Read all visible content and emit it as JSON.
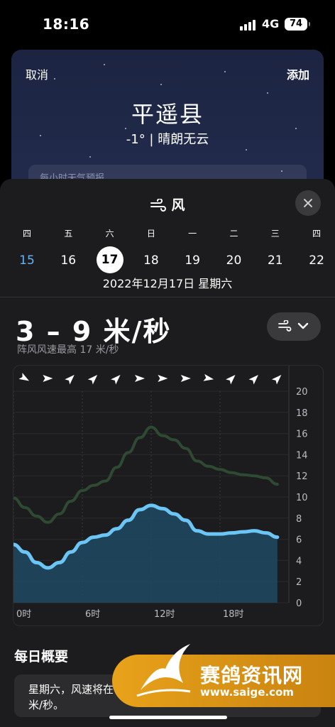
{
  "status_bar": {
    "time": "18:16",
    "network": "4G",
    "battery": "74"
  },
  "location_sheet": {
    "cancel_label": "取消",
    "add_label": "添加",
    "city": "平遥县",
    "condition": "-1° | 晴朗无云",
    "hint": "每小时天气预报"
  },
  "modal": {
    "title": "风",
    "days": [
      {
        "dow": "四",
        "num": "15",
        "state": "today"
      },
      {
        "dow": "五",
        "num": "16",
        "state": ""
      },
      {
        "dow": "六",
        "num": "17",
        "state": "selected"
      },
      {
        "dow": "日",
        "num": "18",
        "state": ""
      },
      {
        "dow": "一",
        "num": "19",
        "state": ""
      },
      {
        "dow": "二",
        "num": "20",
        "state": ""
      },
      {
        "dow": "三",
        "num": "21",
        "state": ""
      },
      {
        "dow": "四",
        "num": "22",
        "state": ""
      }
    ],
    "full_date": "2022年12月17日 星期六",
    "speed_range": "3 – 9 米/秒",
    "gust_text": "阵风风速最高 17 米/秒",
    "summary_title": "每日概要",
    "summary_text": "星期六，风速将在 3 至 9 米/秒之间，阵风风速最高达 17 米/秒。"
  },
  "chart_data": {
    "type": "area",
    "x_labels": [
      "0时",
      "6时",
      "12时",
      "18时"
    ],
    "ylim": [
      0,
      20
    ],
    "y_ticks": [
      0,
      2,
      4,
      6,
      8,
      10,
      12,
      14,
      16,
      18,
      20
    ],
    "x_hours": [
      0,
      1,
      2,
      3,
      4,
      5,
      6,
      7,
      8,
      9,
      10,
      11,
      12,
      13,
      14,
      15,
      16,
      17,
      18,
      19,
      20,
      21,
      22,
      23
    ],
    "series": [
      {
        "values": [
          5.5,
          4.8,
          3.8,
          3.3,
          3.8,
          4.8,
          5.7,
          6.2,
          6.4,
          7.0,
          7.8,
          8.8,
          9.2,
          8.9,
          8.4,
          7.8,
          6.8,
          6.5,
          6.5,
          6.6,
          6.7,
          6.8,
          6.6,
          6.2
        ],
        "color": "#6cc6f5"
      },
      {
        "values": [
          9.9,
          9.0,
          8.2,
          7.6,
          8.4,
          9.6,
          10.6,
          11.1,
          11.5,
          12.8,
          14.2,
          15.6,
          16.6,
          15.8,
          15.4,
          14.6,
          13.4,
          12.9,
          12.6,
          12.3,
          12.1,
          12.0,
          11.8,
          11.2
        ],
        "color": "#2e4a32"
      }
    ],
    "wind_direction_hours": [
      0,
      2,
      4,
      6,
      8,
      10,
      12,
      14,
      16,
      18,
      20,
      22
    ],
    "wind_direction_deg": [
      120,
      90,
      45,
      45,
      45,
      90,
      90,
      90,
      100,
      45,
      45,
      45
    ]
  },
  "watermark": {
    "text": "赛鸽资讯网",
    "url": "www.saige.com"
  }
}
